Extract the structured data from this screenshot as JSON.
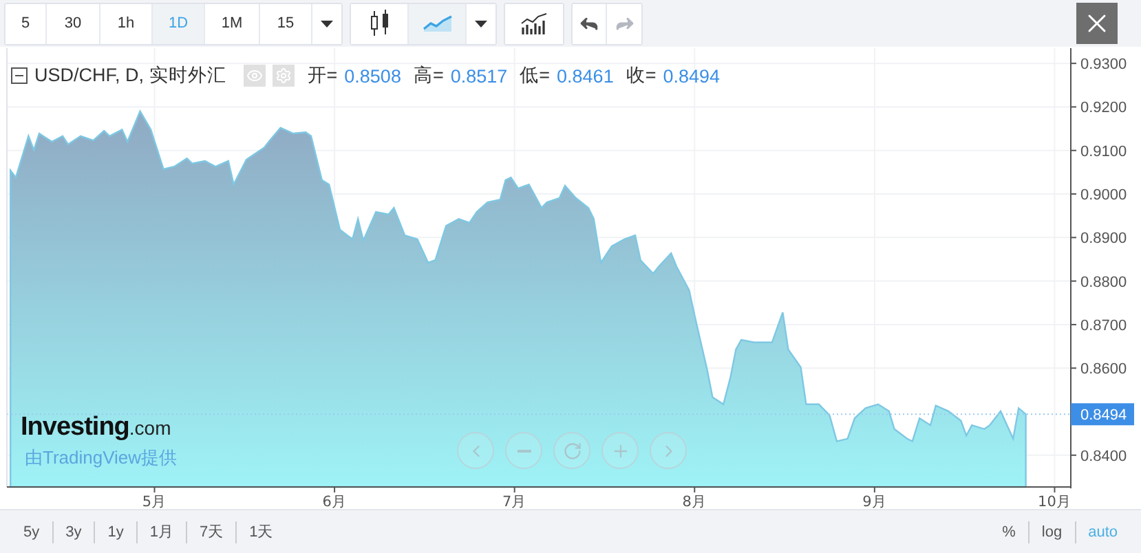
{
  "toolbar": {
    "intervals": [
      {
        "label": "5",
        "selected": false
      },
      {
        "label": "30",
        "selected": false
      },
      {
        "label": "1h",
        "selected": false
      },
      {
        "label": "1D",
        "selected": true
      },
      {
        "label": "1M",
        "selected": false
      },
      {
        "label": "15",
        "selected": false
      }
    ],
    "chart_types": [
      {
        "kind": "candles",
        "selected": false
      },
      {
        "kind": "area",
        "selected": true
      }
    ],
    "history": [
      {
        "kind": "undo",
        "disabled": false
      },
      {
        "kind": "redo",
        "disabled": true
      }
    ]
  },
  "legend": {
    "title": "USD/CHF, D, 实时外汇",
    "values": [
      {
        "label": "开=",
        "value": "0.8508"
      },
      {
        "label": "高=",
        "value": "0.8517"
      },
      {
        "label": "低=",
        "value": "0.8461"
      },
      {
        "label": "收=",
        "value": "0.8494"
      }
    ]
  },
  "logo": {
    "name": "Investing",
    "suffix": ".com",
    "tagline": "由TradingView提供"
  },
  "chart": {
    "last_price_label": "0.8494",
    "chart_data": {
      "type": "area",
      "grid": true,
      "ref_lines": [
        {
          "axis": "y",
          "value": 0.8494,
          "color": "#9cc9ef"
        }
      ],
      "xlim": [
        4.18,
        10.09
      ],
      "ylim": [
        0.8327,
        0.9335
      ],
      "xticks": [
        {
          "value": 5,
          "label": "5月"
        },
        {
          "value": 6,
          "label": "6月"
        },
        {
          "value": 7,
          "label": "7月"
        },
        {
          "value": 8,
          "label": "8月"
        },
        {
          "value": 9,
          "label": "9月"
        },
        {
          "value": 10,
          "label": "10月"
        }
      ],
      "yticks": [
        {
          "value": 0.93,
          "label": "0.9300"
        },
        {
          "value": 0.92,
          "label": "0.9200"
        },
        {
          "value": 0.91,
          "label": "0.9100"
        },
        {
          "value": 0.9,
          "label": "0.9000"
        },
        {
          "value": 0.89,
          "label": "0.8900"
        },
        {
          "value": 0.88,
          "label": "0.8800"
        },
        {
          "value": 0.87,
          "label": "0.8700"
        },
        {
          "value": 0.86,
          "label": "0.8600"
        },
        {
          "value": 0.84,
          "label": "0.8400"
        }
      ],
      "x": [
        4.2,
        4.23,
        4.3,
        4.33,
        4.36,
        4.43,
        4.49,
        4.52,
        4.59,
        4.66,
        4.72,
        4.75,
        4.82,
        4.85,
        4.92,
        4.98,
        5.05,
        5.11,
        5.18,
        5.21,
        5.28,
        5.34,
        5.41,
        5.44,
        5.51,
        5.61,
        5.64,
        5.7,
        5.77,
        5.84,
        5.87,
        5.93,
        5.97,
        6.03,
        6.1,
        6.13,
        6.16,
        6.23,
        6.3,
        6.33,
        6.39,
        6.46,
        6.52,
        6.56,
        6.62,
        6.69,
        6.75,
        6.79,
        6.85,
        6.92,
        6.95,
        6.98,
        7.02,
        7.08,
        7.15,
        7.18,
        7.25,
        7.28,
        7.34,
        7.41,
        7.44,
        7.48,
        7.54,
        7.61,
        7.67,
        7.7,
        7.77,
        7.8,
        7.87,
        7.9,
        7.97,
        8.0,
        8.07,
        8.1,
        8.16,
        8.2,
        8.23,
        8.26,
        8.33,
        8.39,
        8.43,
        8.49,
        8.52,
        8.59,
        8.62,
        8.69,
        8.75,
        8.79,
        8.85,
        8.89,
        8.95,
        9.02,
        9.08,
        9.11,
        9.18,
        9.21,
        9.25,
        9.31,
        9.34,
        9.41,
        9.48,
        9.51,
        9.54,
        9.61,
        9.64,
        9.7,
        9.77,
        9.8,
        9.84
      ],
      "series": [
        {
          "color": "#7ec8e3",
          "values": [
            0.9054,
            0.9038,
            0.9133,
            0.9101,
            0.9139,
            0.912,
            0.9133,
            0.9114,
            0.9133,
            0.9123,
            0.9145,
            0.9133,
            0.9148,
            0.912,
            0.919,
            0.9148,
            0.9057,
            0.9063,
            0.9082,
            0.907,
            0.9076,
            0.9063,
            0.9076,
            0.9022,
            0.9079,
            0.9107,
            0.9123,
            0.9152,
            0.9139,
            0.9142,
            0.9133,
            0.9032,
            0.9022,
            0.8918,
            0.8896,
            0.8943,
            0.8893,
            0.8959,
            0.8953,
            0.8968,
            0.8905,
            0.8896,
            0.8842,
            0.8848,
            0.8927,
            0.8943,
            0.8934,
            0.8959,
            0.8981,
            0.8987,
            0.9032,
            0.9038,
            0.9013,
            0.9022,
            0.8968,
            0.8981,
            0.8991,
            0.9019,
            0.8991,
            0.8968,
            0.8943,
            0.8842,
            0.888,
            0.8896,
            0.8905,
            0.8848,
            0.8817,
            0.8833,
            0.8864,
            0.8833,
            0.8779,
            0.8722,
            0.8596,
            0.8533,
            0.8517,
            0.858,
            0.8643,
            0.8665,
            0.8659,
            0.8659,
            0.8659,
            0.8728,
            0.8643,
            0.8602,
            0.8517,
            0.8517,
            0.8492,
            0.8432,
            0.8438,
            0.8485,
            0.8508,
            0.8517,
            0.8501,
            0.846,
            0.8438,
            0.8432,
            0.8485,
            0.8469,
            0.8514,
            0.8501,
            0.8479,
            0.8445,
            0.8469,
            0.846,
            0.8469,
            0.8501,
            0.8438,
            0.8508,
            0.8494
          ]
        }
      ]
    }
  },
  "ranges": [
    {
      "label": "5y"
    },
    {
      "label": "3y"
    },
    {
      "label": "1y"
    },
    {
      "label": "1月"
    },
    {
      "label": "7天"
    },
    {
      "label": "1天"
    }
  ],
  "scale_options": [
    {
      "label": "%",
      "selected": false
    },
    {
      "label": "log",
      "selected": false
    },
    {
      "label": "auto",
      "selected": true
    }
  ]
}
